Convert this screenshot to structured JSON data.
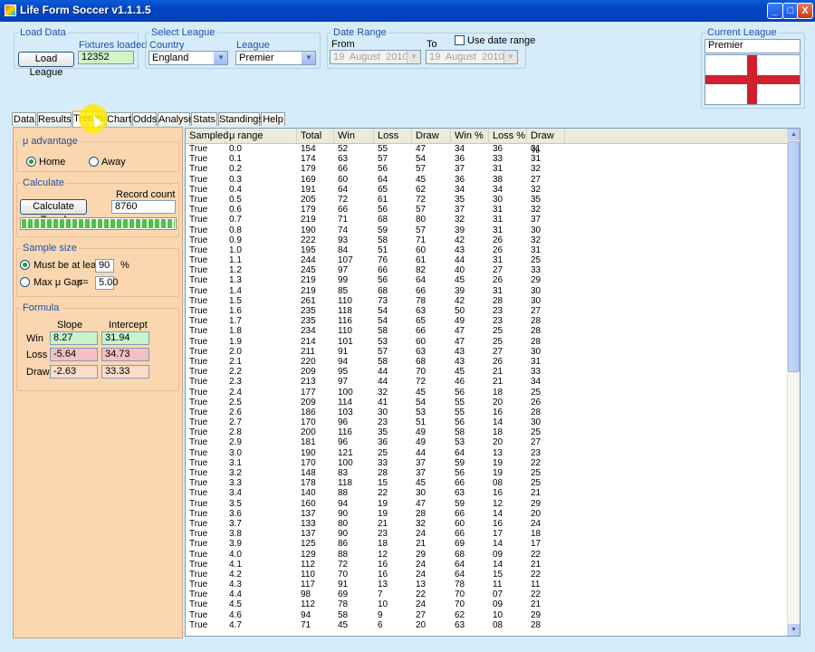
{
  "window": {
    "title": "Life Form Soccer v1.1.1.5",
    "min_glyph": "_",
    "max_glyph": "□",
    "close_glyph": "X"
  },
  "load_data": {
    "legend": "Load Data",
    "button": "Load League",
    "fixtures_label": "Fixtures loaded",
    "fixtures_value": "12352"
  },
  "select_league": {
    "legend": "Select League",
    "country_label": "Country",
    "country_value": "England",
    "league_label": "League",
    "league_value": "Premier"
  },
  "date_range": {
    "legend": "Date Range",
    "from_label": "From",
    "to_label": "To",
    "use_label": "Use date range",
    "use_checked": false,
    "from_day": "19",
    "from_month": "August",
    "from_year": "2010",
    "to_day": "19",
    "to_month": "August",
    "to_year": "2010"
  },
  "current_league": {
    "legend": "Current League",
    "value": "Premier"
  },
  "tabs": [
    {
      "label": "Data"
    },
    {
      "label": "Results"
    },
    {
      "label": "Trends"
    },
    {
      "label": "Chart"
    },
    {
      "label": "Odds"
    },
    {
      "label": "Analyse"
    },
    {
      "label": "Stats"
    },
    {
      "label": "Standings"
    },
    {
      "label": "Help"
    }
  ],
  "active_tab": "Trends",
  "mu_advantage": {
    "title": "μ advantage",
    "home": "Home",
    "away": "Away",
    "selected": "Home"
  },
  "calculate": {
    "title": "Calculate",
    "button": "Calculate Trend",
    "record_label": "Record count",
    "record_value": "8760",
    "progress": 1.0
  },
  "sample_size": {
    "title": "Sample size",
    "opt1": "Must be at least",
    "opt1_value": "90",
    "opt1_unit": "%",
    "opt2": "Max μ Gap",
    "opt2_op": "<=",
    "opt2_value": "5.00",
    "selected": "opt1"
  },
  "formula": {
    "title": "Formula",
    "slope_header": "Slope",
    "intercept_header": "Intercept",
    "rows": [
      {
        "label": "Win",
        "slope": "8.27",
        "intercept": "31.94",
        "color": "#c9f3c9"
      },
      {
        "label": "Loss",
        "slope": "-5.64",
        "intercept": "34.73",
        "color": "#f7c0c0"
      },
      {
        "label": "Draw",
        "slope": "-2.63",
        "intercept": "33.33",
        "color": "#fbdcc8"
      }
    ]
  },
  "table": {
    "headers": [
      "Sampled",
      "μ range",
      "Total",
      "Win",
      "Loss",
      "Draw",
      "Win %",
      "Loss %",
      "Draw %"
    ],
    "rows": [
      [
        "True",
        "0.0",
        "154",
        "52",
        "55",
        "47",
        "34",
        "36",
        "31"
      ],
      [
        "True",
        "0.1",
        "174",
        "63",
        "57",
        "54",
        "36",
        "33",
        "31"
      ],
      [
        "True",
        "0.2",
        "179",
        "66",
        "56",
        "57",
        "37",
        "31",
        "32"
      ],
      [
        "True",
        "0.3",
        "169",
        "60",
        "64",
        "45",
        "36",
        "38",
        "27"
      ],
      [
        "True",
        "0.4",
        "191",
        "64",
        "65",
        "62",
        "34",
        "34",
        "32"
      ],
      [
        "True",
        "0.5",
        "205",
        "72",
        "61",
        "72",
        "35",
        "30",
        "35"
      ],
      [
        "True",
        "0.6",
        "179",
        "66",
        "56",
        "57",
        "37",
        "31",
        "32"
      ],
      [
        "True",
        "0.7",
        "219",
        "71",
        "68",
        "80",
        "32",
        "31",
        "37"
      ],
      [
        "True",
        "0.8",
        "190",
        "74",
        "59",
        "57",
        "39",
        "31",
        "30"
      ],
      [
        "True",
        "0.9",
        "222",
        "93",
        "58",
        "71",
        "42",
        "26",
        "32"
      ],
      [
        "True",
        "1.0",
        "195",
        "84",
        "51",
        "60",
        "43",
        "26",
        "31"
      ],
      [
        "True",
        "1.1",
        "244",
        "107",
        "76",
        "61",
        "44",
        "31",
        "25"
      ],
      [
        "True",
        "1.2",
        "245",
        "97",
        "66",
        "82",
        "40",
        "27",
        "33"
      ],
      [
        "True",
        "1.3",
        "219",
        "99",
        "56",
        "64",
        "45",
        "26",
        "29"
      ],
      [
        "True",
        "1.4",
        "219",
        "85",
        "68",
        "66",
        "39",
        "31",
        "30"
      ],
      [
        "True",
        "1.5",
        "261",
        "110",
        "73",
        "78",
        "42",
        "28",
        "30"
      ],
      [
        "True",
        "1.6",
        "235",
        "118",
        "54",
        "63",
        "50",
        "23",
        "27"
      ],
      [
        "True",
        "1.7",
        "235",
        "116",
        "54",
        "65",
        "49",
        "23",
        "28"
      ],
      [
        "True",
        "1.8",
        "234",
        "110",
        "58",
        "66",
        "47",
        "25",
        "28"
      ],
      [
        "True",
        "1.9",
        "214",
        "101",
        "53",
        "60",
        "47",
        "25",
        "28"
      ],
      [
        "True",
        "2.0",
        "211",
        "91",
        "57",
        "63",
        "43",
        "27",
        "30"
      ],
      [
        "True",
        "2.1",
        "220",
        "94",
        "58",
        "68",
        "43",
        "26",
        "31"
      ],
      [
        "True",
        "2.2",
        "209",
        "95",
        "44",
        "70",
        "45",
        "21",
        "33"
      ],
      [
        "True",
        "2.3",
        "213",
        "97",
        "44",
        "72",
        "46",
        "21",
        "34"
      ],
      [
        "True",
        "2.4",
        "177",
        "100",
        "32",
        "45",
        "56",
        "18",
        "25"
      ],
      [
        "True",
        "2.5",
        "209",
        "114",
        "41",
        "54",
        "55",
        "20",
        "26"
      ],
      [
        "True",
        "2.6",
        "186",
        "103",
        "30",
        "53",
        "55",
        "16",
        "28"
      ],
      [
        "True",
        "2.7",
        "170",
        "96",
        "23",
        "51",
        "56",
        "14",
        "30"
      ],
      [
        "True",
        "2.8",
        "200",
        "116",
        "35",
        "49",
        "58",
        "18",
        "25"
      ],
      [
        "True",
        "2.9",
        "181",
        "96",
        "36",
        "49",
        "53",
        "20",
        "27"
      ],
      [
        "True",
        "3.0",
        "190",
        "121",
        "25",
        "44",
        "64",
        "13",
        "23"
      ],
      [
        "True",
        "3.1",
        "170",
        "100",
        "33",
        "37",
        "59",
        "19",
        "22"
      ],
      [
        "True",
        "3.2",
        "148",
        "83",
        "28",
        "37",
        "56",
        "19",
        "25"
      ],
      [
        "True",
        "3.3",
        "178",
        "118",
        "15",
        "45",
        "66",
        "08",
        "25"
      ],
      [
        "True",
        "3.4",
        "140",
        "88",
        "22",
        "30",
        "63",
        "16",
        "21"
      ],
      [
        "True",
        "3.5",
        "160",
        "94",
        "19",
        "47",
        "59",
        "12",
        "29"
      ],
      [
        "True",
        "3.6",
        "137",
        "90",
        "19",
        "28",
        "66",
        "14",
        "20"
      ],
      [
        "True",
        "3.7",
        "133",
        "80",
        "21",
        "32",
        "60",
        "16",
        "24"
      ],
      [
        "True",
        "3.8",
        "137",
        "90",
        "23",
        "24",
        "66",
        "17",
        "18"
      ],
      [
        "True",
        "3.9",
        "125",
        "86",
        "18",
        "21",
        "69",
        "14",
        "17"
      ],
      [
        "True",
        "4.0",
        "129",
        "88",
        "12",
        "29",
        "68",
        "09",
        "22"
      ],
      [
        "True",
        "4.1",
        "112",
        "72",
        "16",
        "24",
        "64",
        "14",
        "21"
      ],
      [
        "True",
        "4.2",
        "110",
        "70",
        "16",
        "24",
        "64",
        "15",
        "22"
      ],
      [
        "True",
        "4.3",
        "117",
        "91",
        "13",
        "13",
        "78",
        "11",
        "11"
      ],
      [
        "True",
        "4.4",
        "98",
        "69",
        "7",
        "22",
        "70",
        "07",
        "22"
      ],
      [
        "True",
        "4.5",
        "112",
        "78",
        "10",
        "24",
        "70",
        "09",
        "21"
      ],
      [
        "True",
        "4.6",
        "94",
        "58",
        "9",
        "27",
        "62",
        "10",
        "29"
      ],
      [
        "True",
        "4.7",
        "71",
        "45",
        "6",
        "20",
        "63",
        "08",
        "28"
      ]
    ]
  }
}
